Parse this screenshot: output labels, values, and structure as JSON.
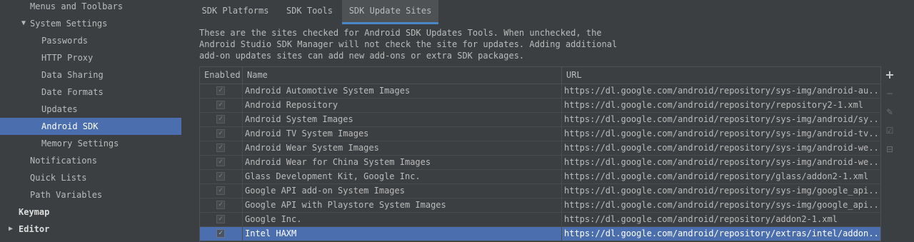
{
  "sidebar": {
    "items": [
      {
        "label": "Menus and Toolbars"
      },
      {
        "label": "System Settings",
        "arrow": "▼"
      },
      {
        "label": "Passwords"
      },
      {
        "label": "HTTP Proxy"
      },
      {
        "label": "Data Sharing"
      },
      {
        "label": "Date Formats"
      },
      {
        "label": "Updates"
      },
      {
        "label": "Android SDK"
      },
      {
        "label": "Memory Settings"
      },
      {
        "label": "Notifications"
      },
      {
        "label": "Quick Lists"
      },
      {
        "label": "Path Variables"
      },
      {
        "label": "Keymap"
      },
      {
        "label": "Editor",
        "arrow": "▶"
      }
    ],
    "selected": "Android SDK"
  },
  "tabs": [
    {
      "label": "SDK Platforms"
    },
    {
      "label": "SDK Tools"
    },
    {
      "label": "SDK Update Sites"
    }
  ],
  "active_tab": "SDK Update Sites",
  "description": "These are the sites checked for Android SDK Updates Tools. When unchecked, the\nAndroid Studio SDK Manager will not check the site for updates. Adding additional\nadd-on updates sites can add new add-ons or extra SDK packages.",
  "table": {
    "headers": {
      "enabled": "Enabled",
      "name": "Name",
      "url": "URL"
    },
    "rows": [
      {
        "checked": true,
        "name": "Android Automotive System Images",
        "url": "https://dl.google.com/android/repository/sys-img/android-au..."
      },
      {
        "checked": true,
        "name": "Android Repository",
        "url": "https://dl.google.com/android/repository/repository2-1.xml"
      },
      {
        "checked": true,
        "name": "Android System Images",
        "url": "https://dl.google.com/android/repository/sys-img/android/sy..."
      },
      {
        "checked": true,
        "name": "Android TV System Images",
        "url": "https://dl.google.com/android/repository/sys-img/android-tv..."
      },
      {
        "checked": true,
        "name": "Android Wear System Images",
        "url": "https://dl.google.com/android/repository/sys-img/android-we..."
      },
      {
        "checked": true,
        "name": "Android Wear for China System Images",
        "url": "https://dl.google.com/android/repository/sys-img/android-we..."
      },
      {
        "checked": true,
        "name": "Glass Development Kit, Google Inc.",
        "url": "https://dl.google.com/android/repository/glass/addon2-1.xml"
      },
      {
        "checked": true,
        "name": "Google API add-on System Images",
        "url": "https://dl.google.com/android/repository/sys-img/google_api..."
      },
      {
        "checked": true,
        "name": "Google API with Playstore System Images",
        "url": "https://dl.google.com/android/repository/sys-img/google_api..."
      },
      {
        "checked": true,
        "name": "Google Inc.",
        "url": "https://dl.google.com/android/repository/addon2-1.xml"
      },
      {
        "checked": true,
        "name": "Intel HAXM",
        "url": "https://dl.google.com/android/repository/extras/intel/addon..."
      }
    ],
    "selected_row": "Intel HAXM"
  },
  "toolbar": {
    "add": "+",
    "remove": "−",
    "edit": "✎",
    "check_all": "☑",
    "uncheck_all": "⊟"
  },
  "check_glyph": "✓"
}
